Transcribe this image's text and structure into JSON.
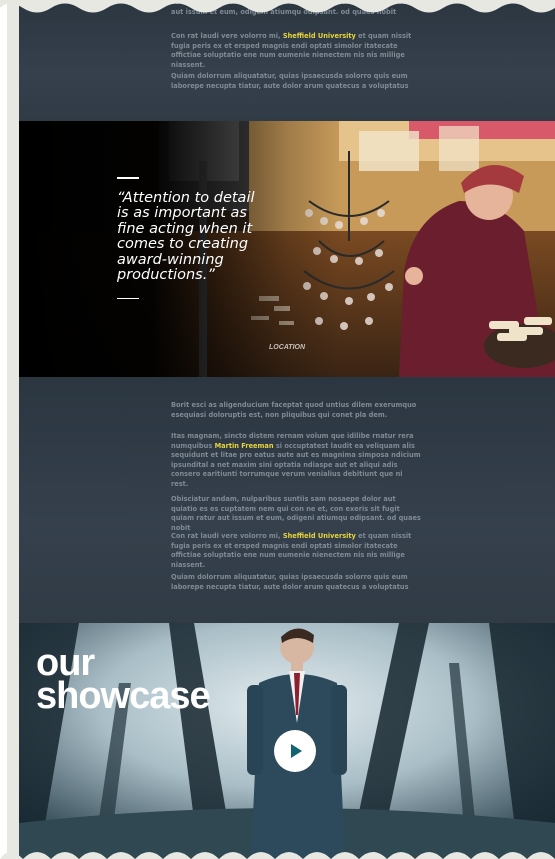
{
  "section_top": {
    "paragraphs": [
      {
        "before": "es es cuptatem nem qui con ne et, con exeris sit fugit quiam ratur aut issum et eum, odigeni atiumqu odipsant. od quaes nobit",
        "highlight": "",
        "after": ""
      },
      {
        "before": "Con rat laudi vere volorro mi, ",
        "highlight": "Sheffield University",
        "after": " et quam nissit fugia peris ex et ersped magnis endi optati simolor itatecate offictiae soluptatio ene num eumenie nienectem nis nis millige niassent."
      },
      {
        "before": "Quiam dolorrum aliquatatur, quias ipsaecusda solorro quis eum laborepe necupta tiatur, aute dolor arum quatecus a voluptatus",
        "highlight": "",
        "after": ""
      }
    ]
  },
  "quote_section": {
    "quote": "“Attention to detail is as important as fine acting when it comes to creating award-winning productions.”",
    "photo_label": "LOCATION"
  },
  "section_bottom": {
    "paragraphs": [
      {
        "before": "Borit esci as aligenducium faceptat quod untius dilem exerumquo esequiasi doloruptis est, non pliquibus qui conet pla dem.",
        "highlight": "",
        "after": ""
      },
      {
        "before": "Itas magnam, sincto distem rernam volum que idilibe rnatur rera numquibus ",
        "highlight": "Martin Freeman",
        "after": " si occuptatest laudit ea veliquam alis sequidunt et litae pro eatus aute aut es magnima simposa ndicium ipsundital a net maxim sini optatia ndiaspe aut et aliqui adis consero earitiunti torrumque verum venialius debitiunt que ni rest."
      },
      {
        "before": "Obisciatur andam, nulparibus suntiis sam nosaepe dolor aut quiatio es es cuptatem nem qui con ne et, con exeris sit fugit quiam ratur aut issum et eum, odigeni atiumqu odipsant. od quaes nobit",
        "highlight": "",
        "after": ""
      },
      {
        "before": "Con rat laudi vere volorro mi, ",
        "highlight": "Sheffield University",
        "after": " et quam nissit fugia peris ex et ersped magnis endi optati simolor itatecate offictiae soluptatio ene num eumenie nienectem nis nis millige niassent."
      },
      {
        "before": "Quiam dolorrum aliquatatur, quias ipsaecusda solorro quis eum laborepe necupta tiatur, aute dolor arum quatecus a voluptatus",
        "highlight": "",
        "after": ""
      }
    ]
  },
  "showcase": {
    "title_line1": "our",
    "title_line2": "showcase",
    "play_icon": "play-icon"
  },
  "colors": {
    "background": "#2f3a45",
    "highlight": "#e7d53a",
    "body_text": "#7f8a95",
    "play_accent": "#10656f"
  }
}
